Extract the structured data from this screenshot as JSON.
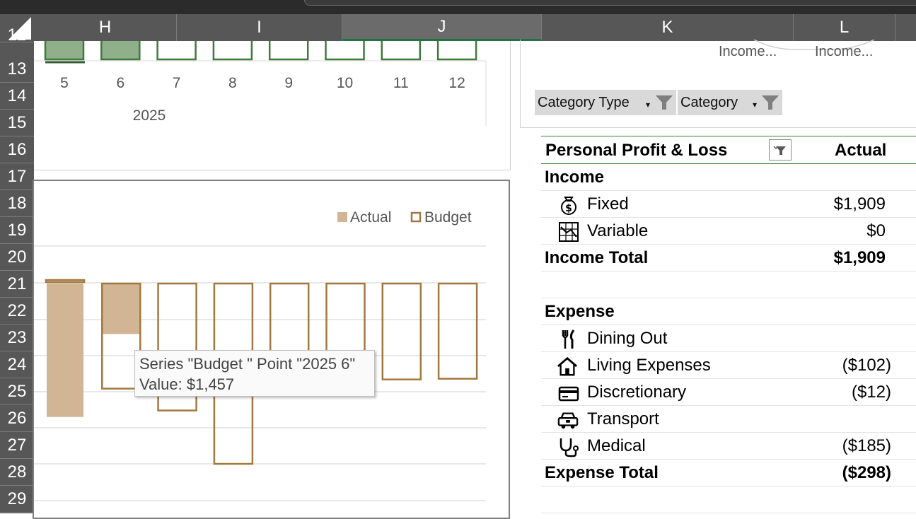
{
  "columns": [
    "H",
    "I",
    "J",
    "K",
    "L"
  ],
  "rows": [
    "12",
    "13",
    "14",
    "15",
    "16",
    "17",
    "18",
    "19",
    "20",
    "21",
    "22",
    "23",
    "24",
    "25",
    "26",
    "27",
    "28",
    "29"
  ],
  "top_chart": {
    "x_labels": [
      "5",
      "6",
      "7",
      "8",
      "9",
      "10",
      "11",
      "12"
    ],
    "year_label": "2025",
    "bar_color": "#8fb08a",
    "outline_color": "#3f7a3d"
  },
  "bottom_chart": {
    "legend": {
      "actual": "Actual",
      "budget": "Budget"
    },
    "colors": {
      "actual": "#d2b594",
      "budget": "#a2783e"
    },
    "tooltip_line1": "Series \"Budget \" Point \"2025 6\"",
    "tooltip_line2": "Value: $1,457"
  },
  "chart_data": {
    "type": "bar",
    "categories": [
      "5",
      "6",
      "7",
      "8",
      "9",
      "10",
      "11",
      "12"
    ],
    "series": [
      {
        "name": "Actual",
        "values": [
          -1850,
          -700,
          0,
          0,
          0,
          0,
          0,
          0
        ]
      },
      {
        "name": "Budget",
        "values": [
          -20,
          -1457,
          -1760,
          -2500,
          -1200,
          -1200,
          -1330,
          -1320
        ]
      }
    ]
  },
  "slicer": {
    "truncated": [
      "Income...",
      "Income..."
    ],
    "category_type_label": "Category Type",
    "category_label": "Category"
  },
  "pivot": {
    "header": "Personal Profit & Loss",
    "actual_header": "Actual",
    "income_label": "Income",
    "income_items": [
      {
        "label": "Fixed",
        "value": "$1,909",
        "icon": "money-bag-icon"
      },
      {
        "label": "Variable",
        "value": "$0",
        "icon": "chart-grid-icon"
      }
    ],
    "income_total_label": "Income Total",
    "income_total_value": "$1,909",
    "expense_label": "Expense",
    "expense_items": [
      {
        "label": "Dining Out",
        "value": "",
        "icon": "fork-knife-icon"
      },
      {
        "label": "Living Expenses",
        "value": "($102)",
        "icon": "house-icon"
      },
      {
        "label": "Discretionary",
        "value": "($12)",
        "icon": "credit-card-icon"
      },
      {
        "label": "Transport",
        "value": "",
        "icon": "car-icon"
      },
      {
        "label": "Medical",
        "value": "($185)",
        "icon": "stethoscope-icon"
      }
    ],
    "expense_total_label": "Expense Total",
    "expense_total_value": "($298)"
  }
}
